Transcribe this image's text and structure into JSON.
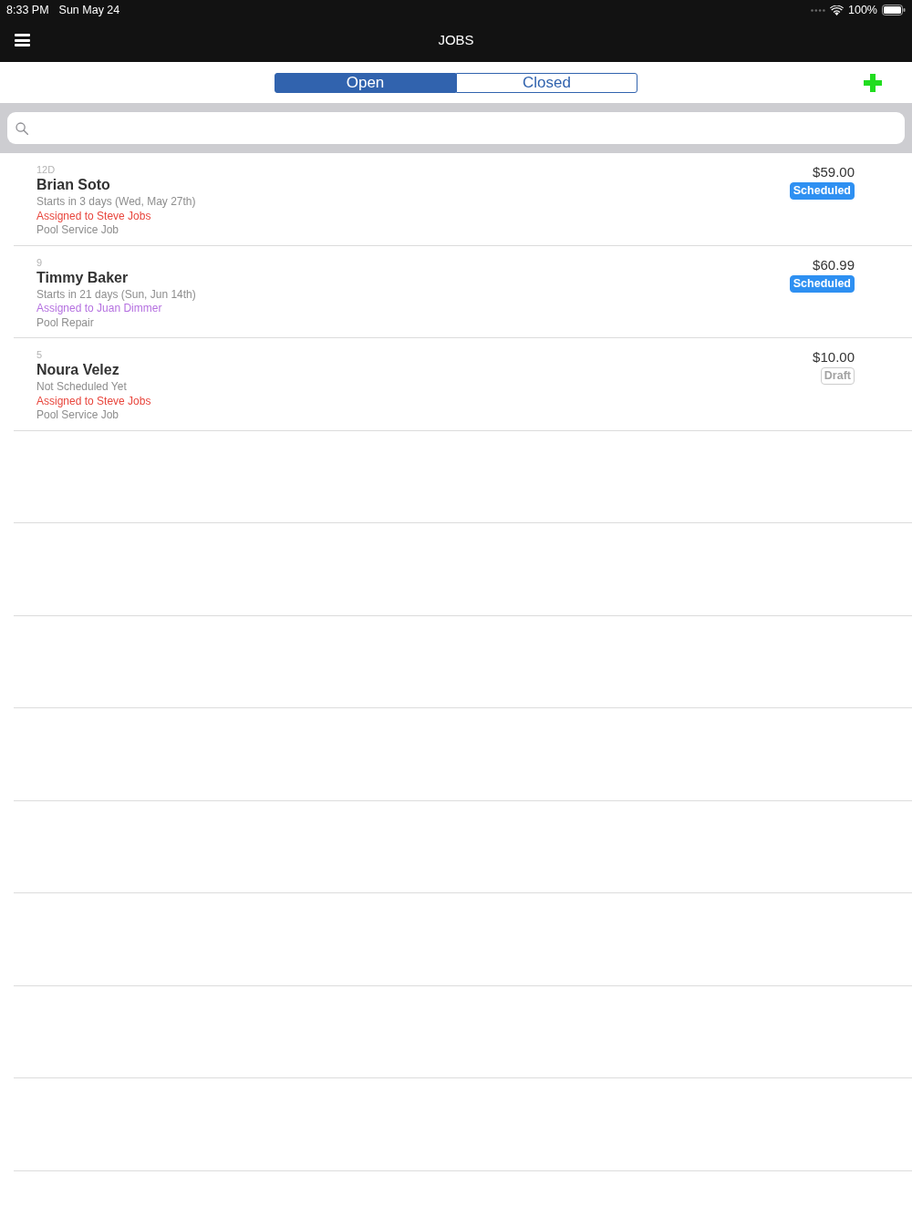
{
  "status_bar": {
    "time": "8:33 PM",
    "date": "Sun May 24",
    "battery": "100%"
  },
  "nav_bar": {
    "title": "JOBS"
  },
  "tabs": [
    {
      "label": "Open",
      "selected": true
    },
    {
      "label": "Closed",
      "selected": false
    }
  ],
  "jobs": [
    {
      "number": "12D",
      "customer": "Brian Soto",
      "schedule": "Starts in 3 days (Wed, May 27th)",
      "assignee": "Assigned to Steve Jobs",
      "color": "#e8453c",
      "job_type": "Pool Service Job",
      "price": "$59.00",
      "status": {
        "label": "Scheduled",
        "kind": "filled"
      }
    },
    {
      "number": "9",
      "customer": "Timmy Baker",
      "schedule": "Starts in 21 days (Sun, Jun 14th)",
      "assignee": "Assigned to Juan Dimmer",
      "color": "#b571e0",
      "job_type": "Pool Repair",
      "price": "$60.99",
      "status": {
        "label": "Scheduled",
        "kind": "filled"
      }
    },
    {
      "number": "5",
      "customer": "Noura Velez",
      "schedule": "Not Scheduled Yet",
      "assignee": "Assigned to Steve Jobs",
      "color": "#e8453c",
      "job_type": "Pool Service Job",
      "price": "$10.00",
      "status": {
        "label": "Draft",
        "kind": "outline"
      }
    }
  ]
}
